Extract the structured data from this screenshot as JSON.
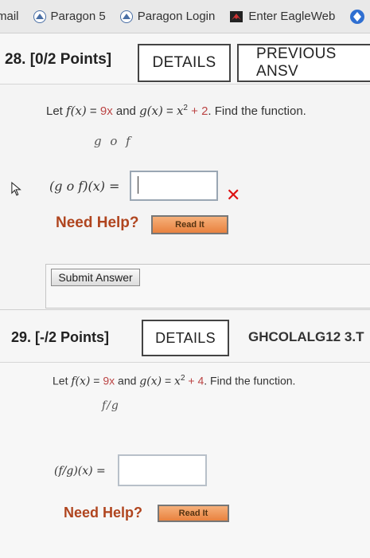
{
  "bookmarks": [
    {
      "label": "mail",
      "icon": "none"
    },
    {
      "label": "Paragon 5",
      "icon": "paragon-icon"
    },
    {
      "label": "Paragon Login",
      "icon": "paragon-icon"
    },
    {
      "label": "Enter EagleWeb",
      "icon": "eagle-icon"
    }
  ],
  "q28": {
    "number": "28. [0/2 Points]",
    "details_label": "DETAILS",
    "prev_label": "PREVIOUS ANSV",
    "stem_prefix": "Let ",
    "stem_f": "f(x)",
    "stem_eq1": " = ",
    "stem_fval": "9x",
    "stem_and": " and ",
    "stem_g": "g(x)",
    "stem_eq2": " = ",
    "stem_gval_base": "x",
    "stem_gval_exp": "2",
    "stem_gval_rest": " + 2",
    "stem_suffix": ". Find the function.",
    "expr": "g o f",
    "answer_label": "(g o f)(x) =",
    "answer_value": "",
    "need_help": "Need Help?",
    "read_it": "Read It",
    "submit_label": "Submit Answer"
  },
  "q29": {
    "number": "29. [-/2 Points]",
    "details_label": "DETAILS",
    "code_label": "GHCOLALG12 3.T",
    "stem_prefix": "Let ",
    "stem_f": "f(x)",
    "stem_eq1": " = ",
    "stem_fval": "9x",
    "stem_and": " and ",
    "stem_g": "g(x)",
    "stem_eq2": " = ",
    "stem_gval_base": "x",
    "stem_gval_exp": "2",
    "stem_gval_rest": " + 4",
    "stem_suffix": ". Find the function.",
    "expr": "f/g",
    "answer_label": "(f/g)(x) =",
    "answer_value": "",
    "need_help": "Need Help?",
    "read_it": "Read It"
  },
  "colors": {
    "need_help": "#b0451f",
    "read_it_orange": "#e9823f",
    "incorrect_x": "#dd1111"
  }
}
